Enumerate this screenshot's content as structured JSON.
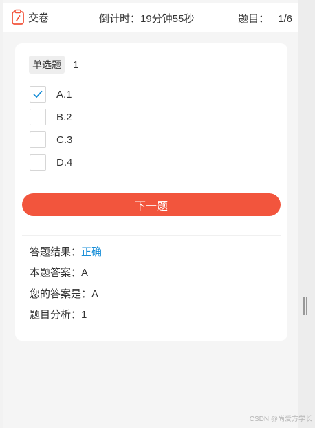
{
  "header": {
    "submit_icon": "clipboard-icon",
    "submit_label": "交卷",
    "timer_text": "倒计时：19分钟55秒",
    "counter_label": "题目：",
    "counter_value": "1/6",
    "accent_color": "#f2553d"
  },
  "question": {
    "type_label": "单选题",
    "text": "1",
    "options": [
      {
        "label": "A.1",
        "checked": true
      },
      {
        "label": "B.2",
        "checked": false
      },
      {
        "label": "C.3",
        "checked": false
      },
      {
        "label": "D.4",
        "checked": false
      }
    ]
  },
  "next_button": {
    "label": "下一题",
    "color": "#f2553d"
  },
  "result": {
    "result_label": "答题结果：",
    "result_value": "正确",
    "result_color": "#1a8fd8",
    "answer_label": "本题答案：",
    "answer_value": "A",
    "your_answer_label": "您的答案是：",
    "your_answer_value": "A",
    "analysis_label": "题目分析：",
    "analysis_value": "1"
  },
  "watermark": "CSDN @尚爱方学长"
}
